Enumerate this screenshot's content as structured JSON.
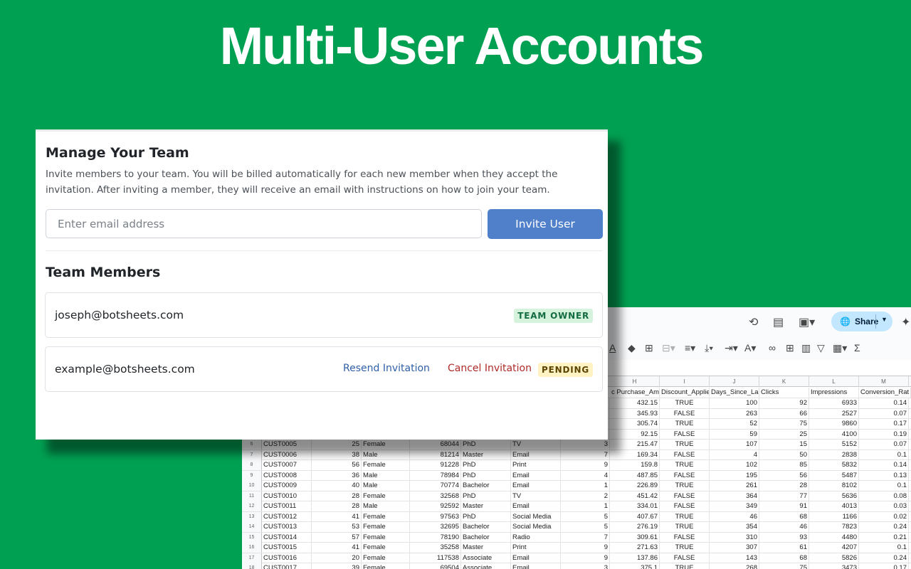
{
  "hero": {
    "title": "Multi-User Accounts"
  },
  "team_panel": {
    "title": "Manage Your Team",
    "description": "Invite members to your team. You will be billed automatically for each new member when they accept the invitation. After inviting a member, they will receive an email with instructions on how to join your team.",
    "email_input": {
      "placeholder": "Enter email address",
      "value": ""
    },
    "invite_button": "Invite User",
    "members_title": "Team Members",
    "members": [
      {
        "email": "joseph@botsheets.com",
        "badge": "TEAM OWNER"
      },
      {
        "email": "example@botsheets.com",
        "resend_label": "Resend Invitation",
        "cancel_label": "Cancel Invitation",
        "badge": "PENDING"
      }
    ]
  },
  "spreadsheet": {
    "share_label": "Share",
    "columns": [
      "H",
      "I",
      "J",
      "K",
      "L",
      "M"
    ],
    "header_cells": [
      "c Purchase_Amou",
      "Discount_Applie",
      "Days_Since_Las",
      "Clicks",
      "Impressions",
      "Conversion_Rat"
    ],
    "rows": [
      {
        "n": "",
        "id": "",
        "age": "",
        "gender": "",
        "income": "",
        "edu": "",
        "channel": "",
        "e": "",
        "amt": "432.15",
        "disc": "TRUE",
        "days": "100",
        "clicks": "92",
        "imp": "6933",
        "conv": "0.14"
      },
      {
        "n": "",
        "id": "",
        "age": "",
        "gender": "",
        "income": "",
        "edu": "",
        "channel": "",
        "e": "",
        "amt": "345.93",
        "disc": "FALSE",
        "days": "263",
        "clicks": "66",
        "imp": "2527",
        "conv": "0.07"
      },
      {
        "n": "",
        "id": "",
        "age": "",
        "gender": "",
        "income": "",
        "edu": "",
        "channel": "",
        "e": "",
        "amt": "305.74",
        "disc": "TRUE",
        "days": "52",
        "clicks": "75",
        "imp": "9860",
        "conv": "0.17"
      },
      {
        "n": "",
        "id": "",
        "age": "",
        "gender": "",
        "income": "",
        "edu": "",
        "channel": "",
        "e": "",
        "amt": "92.15",
        "disc": "FALSE",
        "days": "59",
        "clicks": "25",
        "imp": "4100",
        "conv": "0.19"
      },
      {
        "n": "6",
        "id": "CUST0005",
        "age": "25",
        "gender": "Female",
        "income": "68044",
        "edu": "PhD",
        "channel": "TV",
        "e": "3",
        "amt": "215.47",
        "disc": "TRUE",
        "days": "107",
        "clicks": "15",
        "imp": "5152",
        "conv": "0.07"
      },
      {
        "n": "7",
        "id": "CUST0006",
        "age": "38",
        "gender": "Male",
        "income": "81214",
        "edu": "Master",
        "channel": "Email",
        "e": "7",
        "amt": "169.34",
        "disc": "FALSE",
        "days": "4",
        "clicks": "50",
        "imp": "2838",
        "conv": "0.1"
      },
      {
        "n": "8",
        "id": "CUST0007",
        "age": "56",
        "gender": "Female",
        "income": "91228",
        "edu": "PhD",
        "channel": "Print",
        "e": "9",
        "amt": "159.8",
        "disc": "TRUE",
        "days": "102",
        "clicks": "85",
        "imp": "5832",
        "conv": "0.14"
      },
      {
        "n": "9",
        "id": "CUST0008",
        "age": "36",
        "gender": "Male",
        "income": "78984",
        "edu": "PhD",
        "channel": "Email",
        "e": "4",
        "amt": "487.85",
        "disc": "FALSE",
        "days": "195",
        "clicks": "56",
        "imp": "5487",
        "conv": "0.13"
      },
      {
        "n": "10",
        "id": "CUST0009",
        "age": "40",
        "gender": "Male",
        "income": "70774",
        "edu": "Bachelor",
        "channel": "Email",
        "e": "1",
        "amt": "226.89",
        "disc": "TRUE",
        "days": "261",
        "clicks": "28",
        "imp": "8102",
        "conv": "0.1"
      },
      {
        "n": "11",
        "id": "CUST0010",
        "age": "28",
        "gender": "Female",
        "income": "32568",
        "edu": "PhD",
        "channel": "TV",
        "e": "2",
        "amt": "451.42",
        "disc": "FALSE",
        "days": "364",
        "clicks": "77",
        "imp": "5636",
        "conv": "0.08"
      },
      {
        "n": "12",
        "id": "CUST0011",
        "age": "28",
        "gender": "Male",
        "income": "92592",
        "edu": "Master",
        "channel": "Email",
        "e": "1",
        "amt": "334.01",
        "disc": "FALSE",
        "days": "349",
        "clicks": "91",
        "imp": "4013",
        "conv": "0.03"
      },
      {
        "n": "13",
        "id": "CUST0012",
        "age": "41",
        "gender": "Female",
        "income": "97563",
        "edu": "PhD",
        "channel": "Social Media",
        "e": "5",
        "amt": "407.67",
        "disc": "TRUE",
        "days": "46",
        "clicks": "68",
        "imp": "1166",
        "conv": "0.02"
      },
      {
        "n": "14",
        "id": "CUST0013",
        "age": "53",
        "gender": "Female",
        "income": "32695",
        "edu": "Bachelor",
        "channel": "Social Media",
        "e": "5",
        "amt": "276.19",
        "disc": "TRUE",
        "days": "354",
        "clicks": "46",
        "imp": "7823",
        "conv": "0.24"
      },
      {
        "n": "15",
        "id": "CUST0014",
        "age": "57",
        "gender": "Female",
        "income": "78190",
        "edu": "Bachelor",
        "channel": "Radio",
        "e": "7",
        "amt": "309.61",
        "disc": "FALSE",
        "days": "310",
        "clicks": "93",
        "imp": "4480",
        "conv": "0.21"
      },
      {
        "n": "16",
        "id": "CUST0015",
        "age": "41",
        "gender": "Female",
        "income": "35258",
        "edu": "Master",
        "channel": "Print",
        "e": "9",
        "amt": "271.63",
        "disc": "TRUE",
        "days": "307",
        "clicks": "61",
        "imp": "4207",
        "conv": "0.1"
      },
      {
        "n": "17",
        "id": "CUST0016",
        "age": "20",
        "gender": "Female",
        "income": "117538",
        "edu": "Associate",
        "channel": "Email",
        "e": "9",
        "amt": "137.86",
        "disc": "FALSE",
        "days": "143",
        "clicks": "68",
        "imp": "5826",
        "conv": "0.24"
      },
      {
        "n": "18",
        "id": "CUST0017",
        "age": "39",
        "gender": "Female",
        "income": "69504",
        "edu": "Associate",
        "channel": "Email",
        "e": "3",
        "amt": "375.1",
        "disc": "TRUE",
        "days": "268",
        "clicks": "75",
        "imp": "3473",
        "conv": "0.17"
      }
    ]
  }
}
